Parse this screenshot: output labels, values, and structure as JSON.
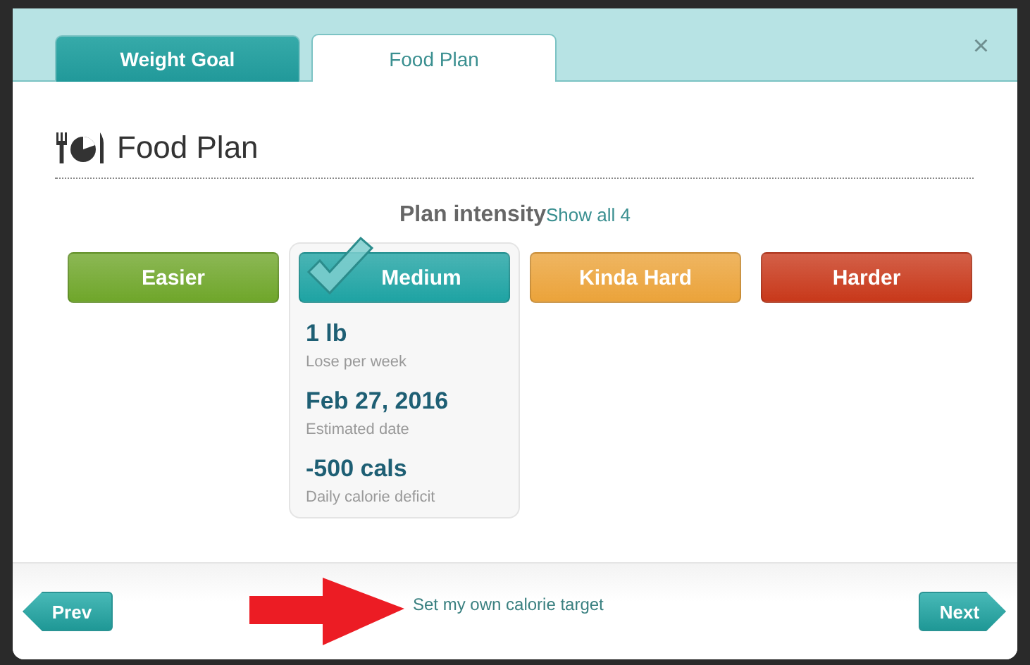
{
  "tabs": [
    {
      "label": "Weight Goal",
      "selected": false
    },
    {
      "label": "Food Plan",
      "selected": true
    }
  ],
  "close": "×",
  "heading": "Food Plan",
  "intensity": {
    "title": "Plan intensity",
    "link": "Show all 4",
    "options": [
      {
        "label": "Easier",
        "color": "#6fa62a",
        "selected": false
      },
      {
        "label": "Medium",
        "color": "#1ea3a3",
        "selected": true
      },
      {
        "label": "Kinda Hard",
        "color": "#eba33a",
        "selected": false
      },
      {
        "label": "Harder",
        "color": "#c8381a",
        "selected": false
      }
    ],
    "stats": [
      {
        "value": "1 lb",
        "caption": "Lose per week"
      },
      {
        "value": "Feb 27, 2016",
        "caption": "Estimated date"
      },
      {
        "value": "-500 cals",
        "caption": "Daily calorie deficit"
      }
    ]
  },
  "footer": {
    "prev": "Prev",
    "link": "Set my own calorie target",
    "next": "Next"
  }
}
